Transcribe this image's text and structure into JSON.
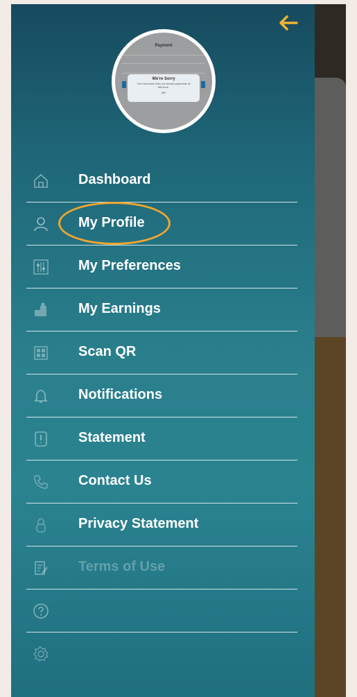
{
  "menu": {
    "items": [
      {
        "label": "Dashboard",
        "icon": "home-icon"
      },
      {
        "label": "My Profile",
        "icon": "user-icon"
      },
      {
        "label": "My Preferences",
        "icon": "preferences-icon"
      },
      {
        "label": "My Earnings",
        "icon": "earnings-icon"
      },
      {
        "label": "Scan QR",
        "icon": "qr-icon"
      },
      {
        "label": "Notifications",
        "icon": "bell-icon"
      },
      {
        "label": "Statement",
        "icon": "statement-icon"
      },
      {
        "label": "Contact Us",
        "icon": "phone-icon"
      },
      {
        "label": "Privacy Statement",
        "icon": "lock-icon"
      },
      {
        "label": "Terms of Use",
        "icon": "terms-icon"
      },
      {
        "label": "",
        "icon": "help-icon"
      },
      {
        "label": "",
        "icon": "settings-icon"
      }
    ]
  },
  "avatar_screenshot": {
    "title": "Payment",
    "dialog_title": "We're Sorry",
    "dialog_message": "The merchant does not accept payments at this time.",
    "dialog_button": "OK"
  },
  "colors": {
    "drawer_top": "#174a5e",
    "drawer_mid": "#2a7f8c",
    "accent": "#f0a630",
    "divider": "#e6f0f2"
  }
}
